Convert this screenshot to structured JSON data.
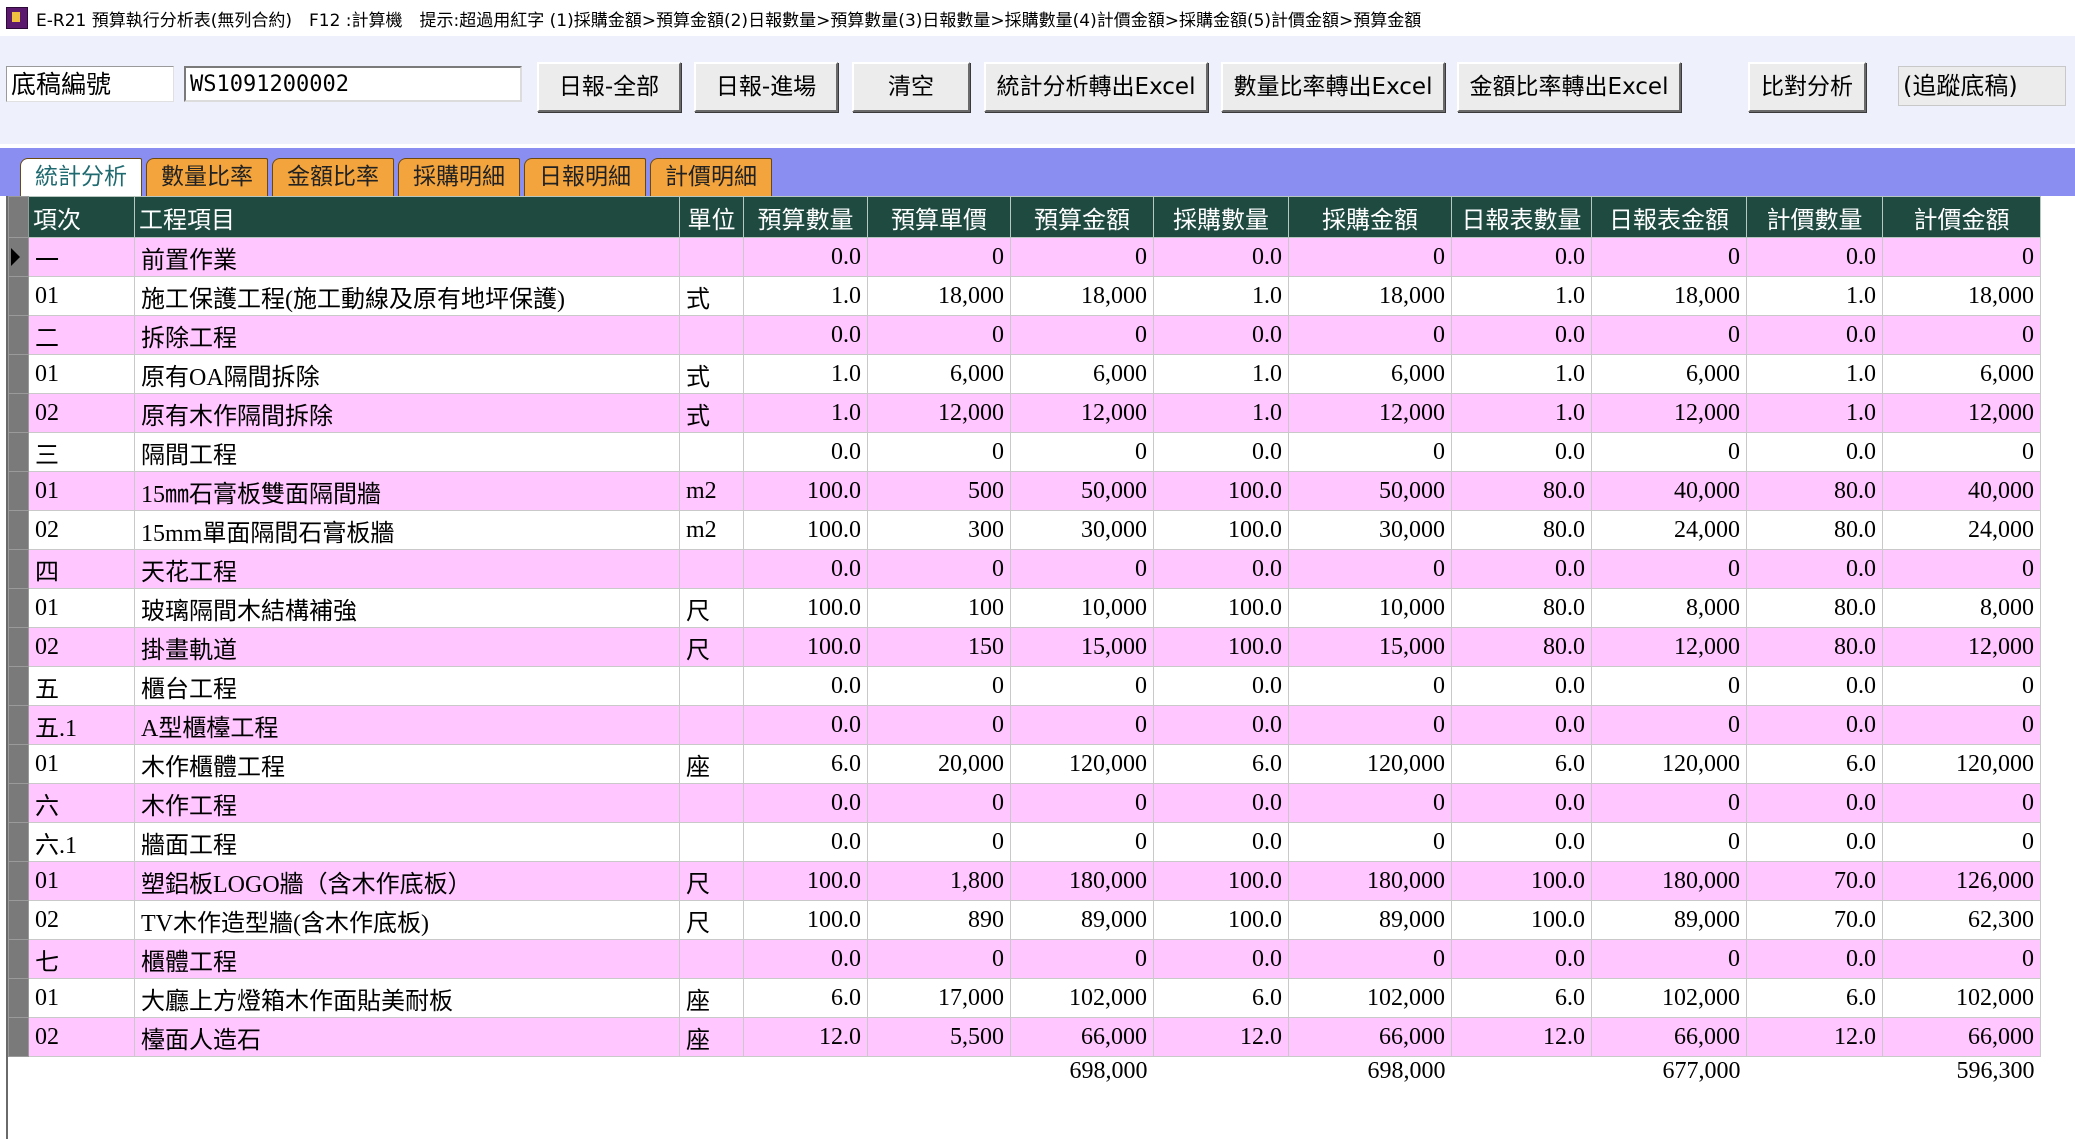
{
  "title_bar": {
    "text": "E-R21 預算執行分析表(無列合約)　F12 :計算機　提示:超過用紅字 (1)採購金額>預算金額(2)日報數量>預算數量(3)日報數量>採購數量(4)計價金額>採購金額(5)計價金額>預算金額"
  },
  "toolbar": {
    "draft_label": "底稿編號",
    "draft_value": "WS1091200002",
    "btn_daily_all": "日報-全部",
    "btn_daily_entry": "日報-進場",
    "btn_clear": "清空",
    "btn_stats_excel": "統計分析轉出Excel",
    "btn_qty_excel": "數量比率轉出Excel",
    "btn_amt_excel": "金額比率轉出Excel",
    "btn_compare": "比對分析",
    "status": "(追蹤底稿)"
  },
  "tabs": [
    "統計分析",
    "數量比率",
    "金額比率",
    "採購明細",
    "日報明細",
    "計價明細"
  ],
  "grid": {
    "headers": [
      "項次",
      "工程項目",
      "單位",
      "預算數量",
      "預算單價",
      "預算金額",
      "採購數量",
      "採購金額",
      "日報表數量",
      "日報表金額",
      "計價數量",
      "計價金額"
    ],
    "rows": [
      [
        "一",
        "前置作業",
        "",
        "0.0",
        "0",
        "0",
        "0.0",
        "0",
        "0.0",
        "0",
        "0.0",
        "0"
      ],
      [
        "01",
        "施工保護工程(施工動線及原有地坪保護)",
        "式",
        "1.0",
        "18,000",
        "18,000",
        "1.0",
        "18,000",
        "1.0",
        "18,000",
        "1.0",
        "18,000"
      ],
      [
        "二",
        "拆除工程",
        "",
        "0.0",
        "0",
        "0",
        "0.0",
        "0",
        "0.0",
        "0",
        "0.0",
        "0"
      ],
      [
        "01",
        "原有OA隔間拆除",
        "式",
        "1.0",
        "6,000",
        "6,000",
        "1.0",
        "6,000",
        "1.0",
        "6,000",
        "1.0",
        "6,000"
      ],
      [
        "02",
        "原有木作隔間拆除",
        "式",
        "1.0",
        "12,000",
        "12,000",
        "1.0",
        "12,000",
        "1.0",
        "12,000",
        "1.0",
        "12,000"
      ],
      [
        "三",
        "隔間工程",
        "",
        "0.0",
        "0",
        "0",
        "0.0",
        "0",
        "0.0",
        "0",
        "0.0",
        "0"
      ],
      [
        "01",
        "15㎜石膏板雙面隔間牆",
        "m2",
        "100.0",
        "500",
        "50,000",
        "100.0",
        "50,000",
        "80.0",
        "40,000",
        "80.0",
        "40,000"
      ],
      [
        "02",
        "15mm單面隔間石膏板牆",
        "m2",
        "100.0",
        "300",
        "30,000",
        "100.0",
        "30,000",
        "80.0",
        "24,000",
        "80.0",
        "24,000"
      ],
      [
        "四",
        "天花工程",
        "",
        "0.0",
        "0",
        "0",
        "0.0",
        "0",
        "0.0",
        "0",
        "0.0",
        "0"
      ],
      [
        "01",
        "玻璃隔間木結構補強",
        "尺",
        "100.0",
        "100",
        "10,000",
        "100.0",
        "10,000",
        "80.0",
        "8,000",
        "80.0",
        "8,000"
      ],
      [
        "02",
        "掛畫軌道",
        "尺",
        "100.0",
        "150",
        "15,000",
        "100.0",
        "15,000",
        "80.0",
        "12,000",
        "80.0",
        "12,000"
      ],
      [
        "五",
        "櫃台工程",
        "",
        "0.0",
        "0",
        "0",
        "0.0",
        "0",
        "0.0",
        "0",
        "0.0",
        "0"
      ],
      [
        "五.1",
        "A型櫃檯工程",
        "",
        "0.0",
        "0",
        "0",
        "0.0",
        "0",
        "0.0",
        "0",
        "0.0",
        "0"
      ],
      [
        "01",
        "木作櫃體工程",
        "座",
        "6.0",
        "20,000",
        "120,000",
        "6.0",
        "120,000",
        "6.0",
        "120,000",
        "6.0",
        "120,000"
      ],
      [
        "六",
        "木作工程",
        "",
        "0.0",
        "0",
        "0",
        "0.0",
        "0",
        "0.0",
        "0",
        "0.0",
        "0"
      ],
      [
        "六.1",
        "牆面工程",
        "",
        "0.0",
        "0",
        "0",
        "0.0",
        "0",
        "0.0",
        "0",
        "0.0",
        "0"
      ],
      [
        "01",
        "塑鋁板LOGO牆（含木作底板）",
        "尺",
        "100.0",
        "1,800",
        "180,000",
        "100.0",
        "180,000",
        "100.0",
        "180,000",
        "70.0",
        "126,000"
      ],
      [
        "02",
        "TV木作造型牆(含木作底板)",
        "尺",
        "100.0",
        "890",
        "89,000",
        "100.0",
        "89,000",
        "100.0",
        "89,000",
        "70.0",
        "62,300"
      ],
      [
        "七",
        "櫃體工程",
        "",
        "0.0",
        "0",
        "0",
        "0.0",
        "0",
        "0.0",
        "0",
        "0.0",
        "0"
      ],
      [
        "01",
        "大廳上方燈箱木作面貼美耐板",
        "座",
        "6.0",
        "17,000",
        "102,000",
        "6.0",
        "102,000",
        "6.0",
        "102,000",
        "6.0",
        "102,000"
      ],
      [
        "02",
        "檯面人造石",
        "座",
        "12.0",
        "5,500",
        "66,000",
        "12.0",
        "66,000",
        "12.0",
        "66,000",
        "12.0",
        "66,000"
      ]
    ],
    "totals": {
      "budget_amount": "698,000",
      "purchase_amount": "698,000",
      "daily_amount": "677,000",
      "valuation_amount": "596,300"
    }
  },
  "colors": {
    "header_bg": "#1e4a40",
    "row_pink": "#ffc6ff",
    "tab_orange": "#f3a43c",
    "tabstrip": "#8a8ef0"
  }
}
